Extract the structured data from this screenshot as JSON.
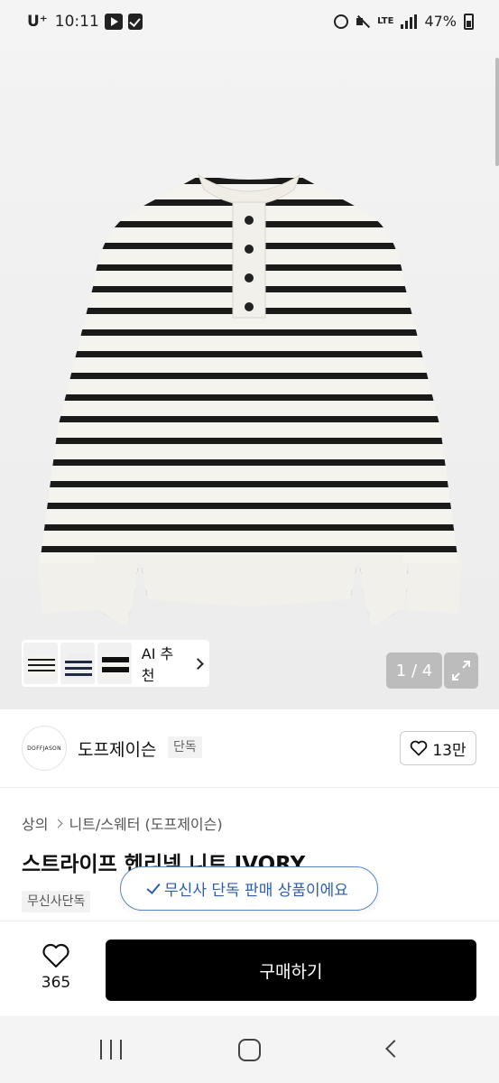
{
  "status_bar": {
    "carrier": "U⁺",
    "time": "10:11",
    "network": "LTE",
    "battery": "47%"
  },
  "hero": {
    "ai_recommend_label": "AI 추천",
    "pager": "1 / 4"
  },
  "brand": {
    "logo_text": "DOFFJASON",
    "name": "도프제이슨",
    "badge": "단독",
    "likes": "13만"
  },
  "product": {
    "breadcrumb": [
      "상의",
      "니트/스웨터 (도프제이슨)"
    ],
    "title": "스트라이프 헨리넥 니트 IVORY",
    "tag": "무신사단독"
  },
  "toast": {
    "message": "무신사 단독 판매 상품이에요"
  },
  "action_bar": {
    "wish_count": "365",
    "buy_label": "구매하기"
  },
  "colors": {
    "buy_button": "#000000",
    "toast_accent": "#2d5fae",
    "hero_bg": "#f0f0f0"
  }
}
